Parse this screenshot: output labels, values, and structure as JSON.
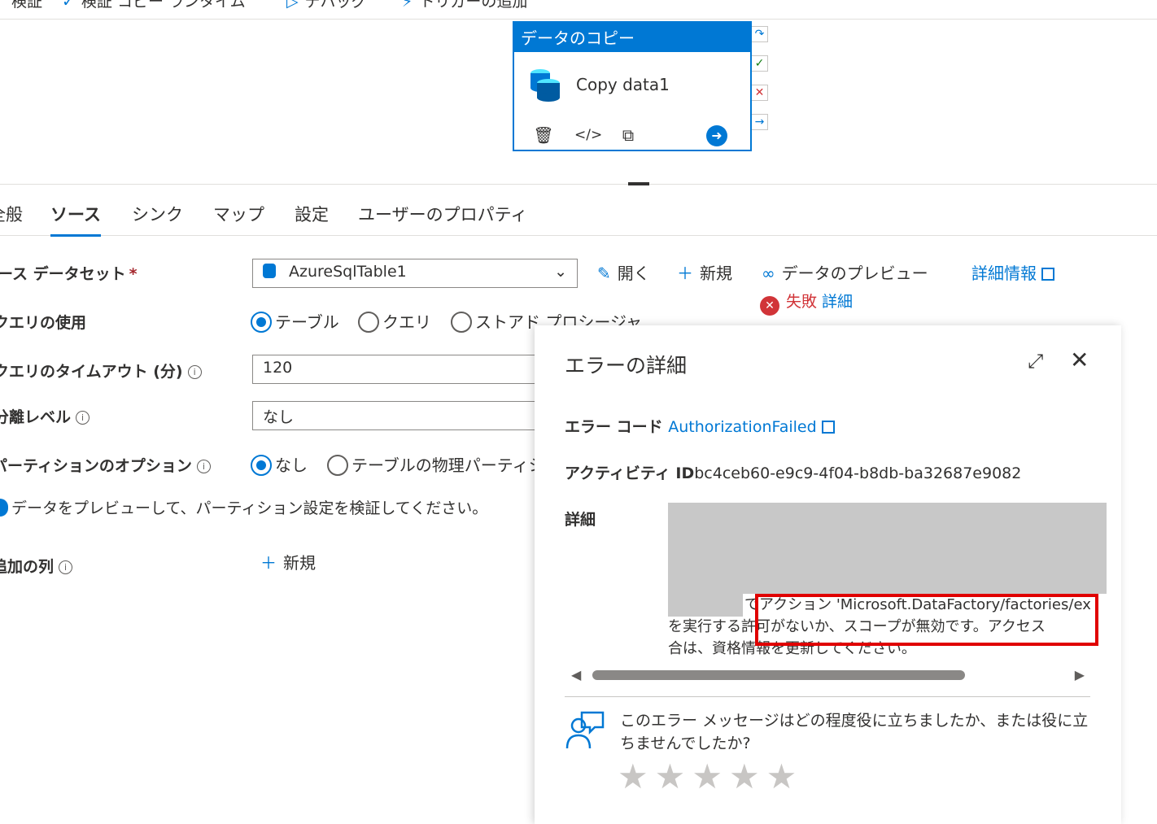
{
  "toolbar": {
    "validate": "検証",
    "validate_copy_runtime": "検証 コピー ランタイム",
    "debug": "デバッグ",
    "add_trigger": "トリガーの追加"
  },
  "activity": {
    "header": "データのコピー",
    "name": "Copy data1"
  },
  "tabs": [
    "全般",
    "ソース",
    "シンク",
    "マップ",
    "設定",
    "ユーザーのプロパティ"
  ],
  "form": {
    "source_dataset_label": "ソース データセット",
    "required_mark": "*",
    "dataset_value": "AzureSqlTable1",
    "open_label": "開く",
    "new_label": "新規",
    "preview_label": "データのプレビュー",
    "more_info_label": "詳細情報",
    "fail_label": "失敗",
    "detail_link": "詳細",
    "use_query_label": "クエリの使用",
    "query_options": [
      "テーブル",
      "クエリ",
      "ストアド プロシージャ"
    ],
    "timeout_label": "クエリのタイムアウト (分)",
    "timeout_value": "120",
    "isolation_label": "分離レベル",
    "isolation_value": "なし",
    "partition_label": "パーティションのオプション",
    "partition_options": [
      "なし",
      "テーブルの物理パーティション"
    ],
    "hint": "データをプレビューして、パーティション設定を検証してください。",
    "additional_cols_label": "追加の列",
    "additional_new": "新規"
  },
  "error_panel": {
    "title": "エラーの詳細",
    "error_code_label": "エラー コード",
    "error_code_value": "AuthorizationFailed",
    "activity_id_label": "アクティビティ ID",
    "activity_id_value": "bc4ceb60-e9c9-4f04-b8db-ba32687e9082",
    "details_label": "詳細",
    "detail_line1": "でアクション 'Microsoft.DataFactory/factories/ex",
    "detail_line2": "を実行する許可がないか、スコープが無効です。アクセス",
    "detail_line3": "合は、資格情報を更新してください。",
    "feedback_question": "このエラー メッセージはどの程度役に立ちましたか、または役に立ちませんでしたか?",
    "rating_max": 5
  },
  "colors": {
    "accent": "#0078d4",
    "error": "#d13438",
    "highlight": "#e00000"
  }
}
